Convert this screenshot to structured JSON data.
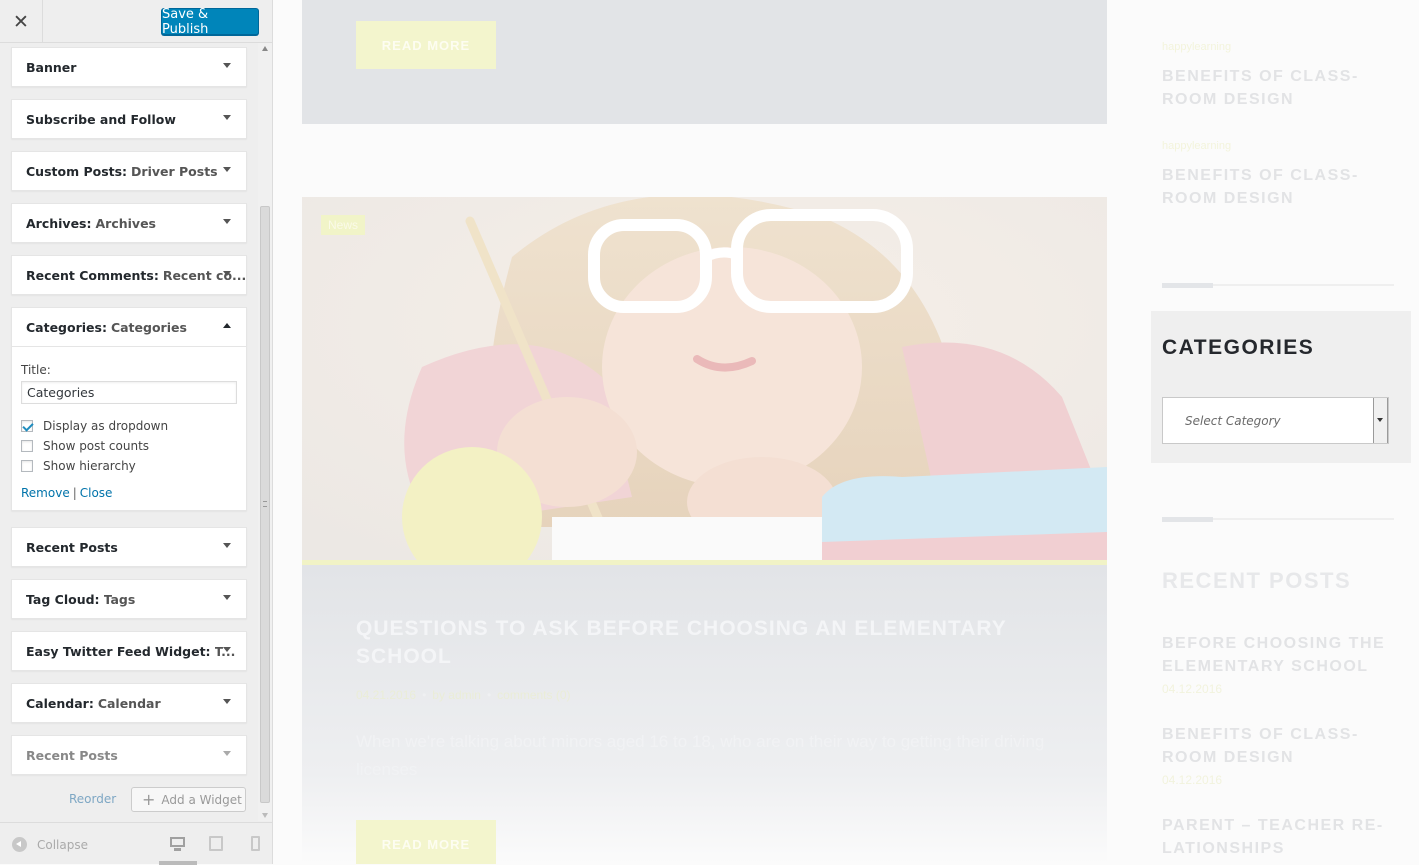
{
  "customizer": {
    "close_label": "✕",
    "publish_label": "Save & Publish",
    "widgets": [
      {
        "title": "Banner",
        "subtitle": ""
      },
      {
        "title": "Subscribe and Follow",
        "subtitle": ""
      },
      {
        "title": "Custom Posts:",
        "subtitle": "Driver Posts"
      },
      {
        "title": "Archives:",
        "subtitle": "Archives"
      },
      {
        "title": "Recent Comments:",
        "subtitle": "Recent co..."
      },
      {
        "title": "Categories:",
        "subtitle": "Categories"
      },
      {
        "title": "Recent Posts",
        "subtitle": ""
      },
      {
        "title": "Tag Cloud:",
        "subtitle": "Tags"
      },
      {
        "title": "Easy Twitter Feed Widget:",
        "subtitle": "T..."
      },
      {
        "title": "Calendar:",
        "subtitle": "Calendar"
      },
      {
        "title": "Recent Posts",
        "subtitle": ""
      }
    ],
    "categories_form": {
      "title_label": "Title:",
      "title_value": "Categories",
      "options": [
        {
          "label": "Display as dropdown",
          "checked": true
        },
        {
          "label": "Show post counts",
          "checked": false
        },
        {
          "label": "Show hierarchy",
          "checked": false
        }
      ],
      "remove_label": "Remove",
      "separator": "|",
      "close_label": "Close"
    },
    "reorder_label": "Reorder",
    "add_widget_label": "Add a Widget",
    "collapse_label": "Collapse",
    "preview_device": "desktop"
  },
  "preview": {
    "read_more_label": "READ MORE",
    "badge": "News",
    "post_title": "QUESTIONS TO ASK BEFORE CHOOSING AN ELEMENTARY SCHOOL",
    "post_date": "04.21.2016",
    "post_author": "by admin",
    "post_comments": "comments (0)",
    "post_excerpt": "When we're talking about minors aged 16 to 18, who are on their way to getting their driving licenses",
    "sidebar": {
      "top_posts": [
        {
          "category": "happylearning",
          "title": "BENEFITS OF CLASS-ROOM DESIGN"
        },
        {
          "category": "happylearning",
          "title": "BENEFITS OF CLASS-ROOM DESIGN"
        }
      ],
      "categories_title": "CATEGORIES",
      "categories_select_placeholder": "Select Category",
      "recent_title": "RECENT POSTS",
      "recent_posts": [
        {
          "title": "BEFORE CHOOSING THE ELEMENTARY SCHOOL",
          "date": "04.12.2016"
        },
        {
          "title": "BENEFITS OF CLASS-ROOM DESIGN",
          "date": "04.12.2016"
        },
        {
          "title": "PARENT – TEACHER RE-LATIONSHIPS",
          "date": ""
        }
      ]
    }
  },
  "colors": {
    "publish": "#0085ba",
    "link": "#0073aa",
    "accent_faded": "#f3f5cd"
  }
}
